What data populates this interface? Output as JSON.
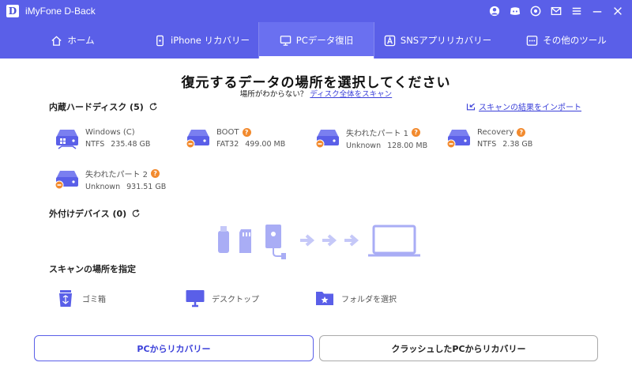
{
  "app": {
    "logo_letter": "D",
    "title": "iMyFone D-Back"
  },
  "titlebar_icons": [
    "user-icon",
    "discord-icon",
    "target-icon",
    "mail-icon",
    "menu-icon",
    "minimize-icon",
    "close-icon"
  ],
  "nav": {
    "tabs": [
      {
        "label": "ホーム",
        "icon": "home-icon",
        "active": false
      },
      {
        "label": "iPhone リカバリー",
        "icon": "phone-icon",
        "active": false
      },
      {
        "label": "PCデータ復旧",
        "icon": "pc-icon",
        "active": true
      },
      {
        "label": "SNSアプリリカバリー",
        "icon": "app-store-icon",
        "active": false
      },
      {
        "label": "その他のツール",
        "icon": "grid-icon",
        "active": false
      }
    ]
  },
  "main": {
    "title": "復元するデータの場所を選択してください",
    "subline_prefix": "場所がわからない？",
    "subline_link": "ディスク全体をスキャン",
    "import_link": "スキャンの結果をインポート"
  },
  "internal": {
    "title": "内蔵ハードディスク (5)",
    "drives": [
      {
        "name": "Windows (C)",
        "fs": "NTFS",
        "size": "235.48 GB",
        "warn": false,
        "os": true
      },
      {
        "name": "BOOT",
        "fs": "FAT32",
        "size": "499.00 MB",
        "warn": true,
        "os": false
      },
      {
        "name": "失われたパート 1",
        "fs": "Unknown",
        "size": "128.00 MB",
        "warn": true,
        "os": false
      },
      {
        "name": "Recovery",
        "fs": "NTFS",
        "size": "2.38 GB",
        "warn": true,
        "os": false
      },
      {
        "name": "失われたパート 2",
        "fs": "Unknown",
        "size": "931.51 GB",
        "warn": true,
        "os": false
      }
    ]
  },
  "external": {
    "title": "外付けデバイス (0)"
  },
  "locations": {
    "title": "スキャンの場所を指定",
    "items": [
      {
        "label": "ゴミ箱",
        "icon": "trash-icon"
      },
      {
        "label": "デスクトップ",
        "icon": "monitor-icon"
      },
      {
        "label": "フォルダを選択",
        "icon": "folder-icon"
      }
    ]
  },
  "buttons": {
    "primary": "PCからリカバリー",
    "secondary": "クラッシュしたPCからリカバリー"
  },
  "colors": {
    "brand": "#5a5fe8",
    "link": "#3b40d9",
    "warn": "#f28a2e",
    "drive": "#5a5fe8",
    "illustration": "#a9adf5"
  }
}
